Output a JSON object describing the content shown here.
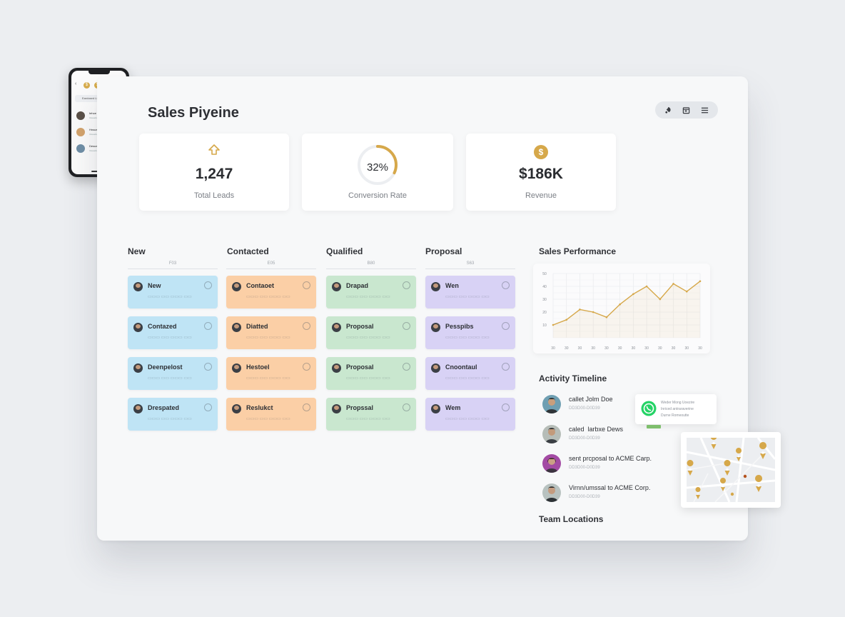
{
  "colors": {
    "accent": "#d6a84a",
    "new": "#bfe4f5",
    "contacted": "#fbcfa6",
    "qualified": "#c9e7cf",
    "proposal": "#d8d2f5",
    "whatsapp": "#25d366"
  },
  "header": {
    "title": "Sales Piyeine",
    "toolbar_icons": [
      "rocket-icon",
      "calendar-icon",
      "menu-icon"
    ]
  },
  "kpis": {
    "leads": {
      "value": "1,247",
      "label": "Total Leads",
      "icon": "arrow-up-icon"
    },
    "conversion": {
      "value": "32%",
      "label": "Conversion Rate",
      "progress": 0.32
    },
    "revenue": {
      "value": "$186K",
      "label": "Revenue",
      "icon": "dollar-icon"
    }
  },
  "pipeline": {
    "columns": [
      {
        "title": "New",
        "count": "F03"
      },
      {
        "title": "Contacted",
        "count": "E05"
      },
      {
        "title": "Qualified",
        "count": "B80"
      },
      {
        "title": "Proposal",
        "count": "S63"
      }
    ],
    "cards": [
      [
        "New",
        "Contazed",
        "Deenpelost",
        "Drespated"
      ],
      [
        "Contaoet",
        "Diatted",
        "Hestoel",
        "Reslukct"
      ],
      [
        "Drapad",
        "Proposal",
        "Proposal",
        "Propssal"
      ],
      [
        "Wen",
        "Pesspibs",
        "Cnoontaul",
        "Wem"
      ]
    ]
  },
  "performance": {
    "title": "Sales Performance"
  },
  "chart_data": {
    "type": "line",
    "title": "Sales Performance",
    "x": [
      "30",
      "30",
      "30",
      "30",
      "30",
      "30",
      "30",
      "30",
      "30",
      "30",
      "30",
      "30"
    ],
    "series": [
      {
        "values": [
          10,
          14,
          22,
          20,
          16,
          26,
          34,
          40,
          30,
          42,
          36,
          44
        ]
      }
    ],
    "ylim": [
      0,
      50
    ],
    "y_ticks": [
      "10",
      "20",
      "30",
      "40",
      "50"
    ],
    "grid": true
  },
  "timeline": {
    "title": "Activity Timeline",
    "items": [
      {
        "text": "callet Jolm Doe",
        "sub": "DD3D00-D0D39"
      },
      {
        "text": "caled  larbxe Dews",
        "sub": "DD3D00-D0D39"
      },
      {
        "text": "sent prcposal to ACME Carp.",
        "sub": "DD3D00-D0D39"
      },
      {
        "text": "Virnn/umssal to ACME Corp.",
        "sub": "DD3D00-D0D39"
      }
    ]
  },
  "whatsapp": {
    "lines": [
      "Weder Mong Uoezire",
      "Inriced antraraverine",
      "Durne Romeoutte"
    ]
  },
  "locations": {
    "title": "Team Locations"
  },
  "phone": {
    "search": "Eardosed Lhdd",
    "rows": [
      {
        "name": "Iehoe Saild",
        "sub": "Ckeaebd ceo"
      },
      {
        "name": "Hnsue Ivinviet",
        "sub": "Ckeaebd ceo"
      },
      {
        "name": "Desue Iutine Sdda",
        "sub": "Ckeaebd ceo"
      }
    ]
  }
}
